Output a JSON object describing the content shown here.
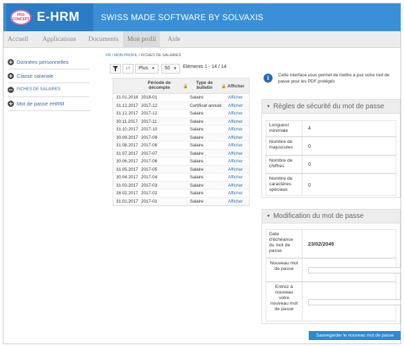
{
  "header": {
    "logo_text": "PRO CONCEPT",
    "brand": "E-HRM",
    "tagline": "SWISS MADE SOFTWARE BY SOLVAXIS",
    "accent": "#3a8fd6"
  },
  "nav": {
    "items": [
      "Accueil",
      "Applications",
      "Documents",
      "Mon profil",
      "Aide"
    ],
    "active": "Mon profil"
  },
  "sidebar": {
    "items": [
      {
        "label": "Données personnelles",
        "icon": "plus-circle-icon"
      },
      {
        "label": "Classe salariale",
        "icon": "plus-circle-icon"
      },
      {
        "label": "FICHES DE SALAIRES",
        "icon": "minus-circle-icon"
      },
      {
        "label": "Mot de passe eHRM",
        "icon": "plus-circle-icon"
      }
    ]
  },
  "breadcrumb": {
    "parts": [
      "FR",
      "MON PROFIL",
      "FICHES DE SALAIRES"
    ],
    "sep": " / "
  },
  "toolbar": {
    "filter_icon": "filter-icon",
    "sort_icon": "sort-icon",
    "more_label": "Plus",
    "page_size": "50",
    "counter": "Eléments 1 - 14 / 14"
  },
  "grid": {
    "columns": [
      "Période de décompte",
      "Type de bulletin",
      "Afficher"
    ],
    "rows": [
      {
        "date": "31.01.2018",
        "period": "2018-01",
        "type": "Salaire",
        "action": "Afficher"
      },
      {
        "date": "31.12.2017",
        "period": "2017-12",
        "type": "Certificat annuel",
        "action": "Afficher"
      },
      {
        "date": "31.12.2017",
        "period": "2017-12",
        "type": "Salaire",
        "action": "Afficher"
      },
      {
        "date": "30.11.2017",
        "period": "2017-11",
        "type": "Salaire",
        "action": "Afficher"
      },
      {
        "date": "31.10.2017",
        "period": "2017-10",
        "type": "Salaire",
        "action": "Afficher"
      },
      {
        "date": "30.09.2017",
        "period": "2017-09",
        "type": "Salaire",
        "action": "Afficher"
      },
      {
        "date": "31.08.2017",
        "period": "2017-08",
        "type": "Salaire",
        "action": "Afficher"
      },
      {
        "date": "31.07.2017",
        "period": "2017-07",
        "type": "Salaire",
        "action": "Afficher"
      },
      {
        "date": "30.06.2017",
        "period": "2017-06",
        "type": "Salaire",
        "action": "Afficher"
      },
      {
        "date": "31.05.2017",
        "period": "2017-05",
        "type": "Salaire",
        "action": "Afficher"
      },
      {
        "date": "30.04.2017",
        "period": "2017-04",
        "type": "Salaire",
        "action": "Afficher"
      },
      {
        "date": "31.03.2017",
        "period": "2017-03",
        "type": "Salaire",
        "action": "Afficher"
      },
      {
        "date": "28.02.2017",
        "period": "2017-02",
        "type": "Salaire",
        "action": "Afficher"
      },
      {
        "date": "31.01.2017",
        "period": "2017-01",
        "type": "Salaire",
        "action": "Afficher"
      }
    ]
  },
  "info": {
    "icon": "info-icon",
    "text": "Cette interface vous permet de mettre à jour votre mot de passe pour les PDF protégés"
  },
  "rules": {
    "title": "Règles de sécurité du mot de passe",
    "rows": [
      {
        "label": "Longueur minimale",
        "value": "4"
      },
      {
        "label": "Nombre de majuscules",
        "value": "0"
      },
      {
        "label": "Nombre de chiffres",
        "value": "0"
      },
      {
        "label": "Nombre de caractères spéciaux",
        "value": "0"
      }
    ]
  },
  "modify": {
    "title": "Modification du mot de passe",
    "expiry_label": "Date d'échéance du mot de passe",
    "expiry_value": "23/02/2045",
    "new_label": "Nouveau mot de passe",
    "new_value": "",
    "repeat_label": "Entrez à nouveau votre nouveau mot de passe",
    "repeat_value": "",
    "save_label": "Sauvegarder le nouveau mot de passe"
  }
}
